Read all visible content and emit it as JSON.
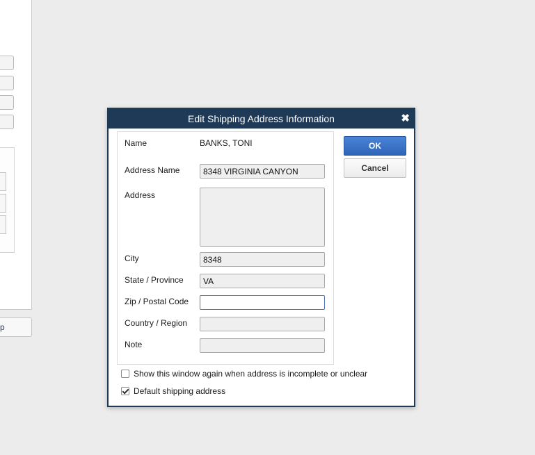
{
  "background": {
    "bottom_button_label": "p"
  },
  "dialog": {
    "title": "Edit Shipping Address Information",
    "close_glyph": "✖",
    "name_label": "Name",
    "name_value": "BANKS, TONI",
    "address_name_label": "Address Name",
    "address_name_value": "8348 VIRGINIA CANYON",
    "address_label": "Address",
    "address_value": "",
    "city_label": "City",
    "city_value": "8348",
    "state_label": "State / Province",
    "state_value": "VA",
    "zip_label": "Zip / Postal Code",
    "zip_value": "",
    "country_label": "Country / Region",
    "country_value": "",
    "note_label": "Note",
    "note_value": "",
    "ok_label": "OK",
    "cancel_label": "Cancel",
    "show_again_label": "Show this window again when address is incomplete or unclear",
    "show_again_checked": false,
    "default_shipping_label": "Default shipping address",
    "default_shipping_checked": true
  },
  "colors": {
    "titlebar": "#1f3a56",
    "ok_button": "#3a72c6",
    "field_bg": "#efefef"
  }
}
